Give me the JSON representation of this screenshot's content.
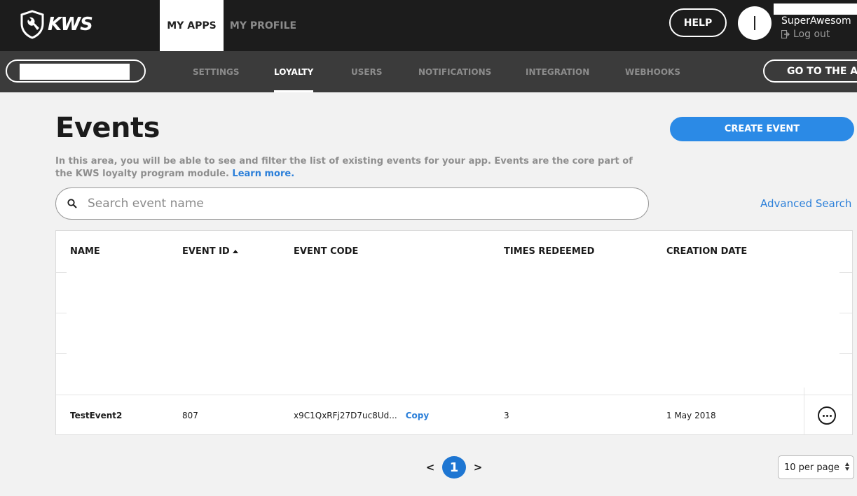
{
  "header": {
    "logo_text": "KWS",
    "tabs": [
      {
        "label": "MY APPS",
        "active": true
      },
      {
        "label": "MY PROFILE",
        "active": false
      }
    ],
    "help_label": "HELP",
    "username": "SuperAwesom",
    "logout_label": "Log out"
  },
  "subnav": {
    "tabs": [
      {
        "label": "SETTINGS",
        "active": false
      },
      {
        "label": "LOYALTY",
        "active": true
      },
      {
        "label": "USERS",
        "active": false
      },
      {
        "label": "NOTIFICATIONS",
        "active": false
      },
      {
        "label": "INTEGRATION",
        "active": false
      },
      {
        "label": "WEBHOOKS",
        "active": false
      }
    ],
    "goto_label": "GO TO THE AP"
  },
  "main": {
    "title": "Events",
    "create_label": "CREATE EVENT",
    "description": "In this area, you will be able to see and filter the list of existing events for your app. Events are the core part of the KWS loyalty program module.",
    "learn_more": "Learn more.",
    "search_placeholder": "Search event name",
    "advanced_search": "Advanced Search"
  },
  "table": {
    "columns": [
      "NAME",
      "EVENT ID",
      "EVENT CODE",
      "TIMES REDEEMED",
      "CREATION DATE"
    ],
    "sorted_column": "EVENT ID",
    "rows": [
      {
        "name": "TestEvent2",
        "event_id": "807",
        "event_code": "x9C1QxRFj27D7uc8Ud...",
        "copy_label": "Copy",
        "times_redeemed": "3",
        "creation_date": "1 May 2018"
      }
    ]
  },
  "pagination": {
    "prev": "<",
    "current_page": "1",
    "next": ">",
    "per_page": "10 per page"
  },
  "colors": {
    "topbar": "#1c1c1c",
    "subbar": "#3b3b3b",
    "accent": "#2b8ae6",
    "link": "#2b7fd9"
  }
}
